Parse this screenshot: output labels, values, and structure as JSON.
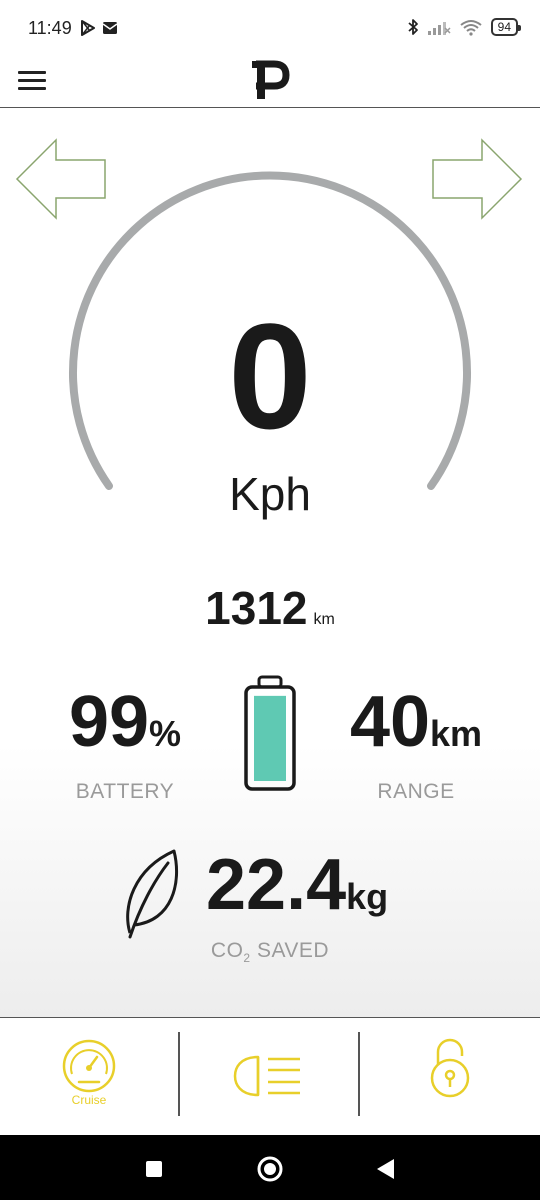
{
  "status_bar": {
    "time": "11:49",
    "battery_level": "94",
    "icons": [
      "play-store-icon",
      "mail-icon",
      "bluetooth-icon",
      "signal-icon",
      "wifi-icon",
      "battery-icon"
    ]
  },
  "header": {
    "logo_letter": "P",
    "menu_icon": "hamburger-menu-icon"
  },
  "speedometer": {
    "speed": "0",
    "unit": "Kph",
    "arc_color": "#a8aaab",
    "left_arrow": "left-arrow-icon",
    "right_arrow": "right-arrow-icon",
    "arrow_color": "#8aa56e"
  },
  "odometer": {
    "value": "1312",
    "unit": "km"
  },
  "battery": {
    "value": "99",
    "unit": "%",
    "label": "BATTERY",
    "level_fraction": 0.99,
    "fill_color": "#5fc9b3"
  },
  "range": {
    "value": "40",
    "unit": "km",
    "label": "RANGE"
  },
  "co2": {
    "value": "22.4",
    "unit": "kg",
    "label_prefix": "CO",
    "label_sub": "2",
    "label_suffix": " SAVED",
    "icon": "leaf-icon"
  },
  "bottom_bar": {
    "accent_color": "#e8cf2a",
    "items": [
      {
        "icon": "speedometer-icon",
        "label": "Cruise"
      },
      {
        "icon": "headlight-icon",
        "label": ""
      },
      {
        "icon": "unlock-icon",
        "label": ""
      }
    ]
  },
  "nav_bar": {
    "buttons": [
      "recents-square-icon",
      "home-circle-icon",
      "back-triangle-icon"
    ]
  }
}
